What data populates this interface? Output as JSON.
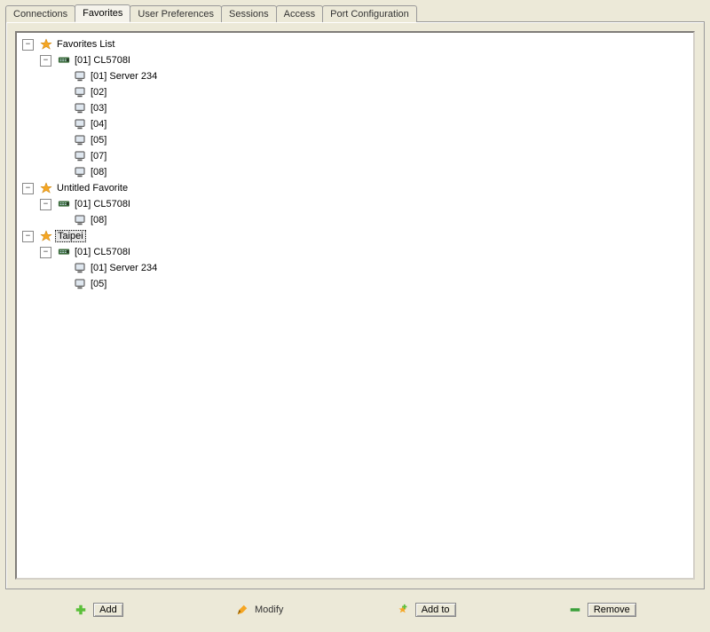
{
  "tabs": [
    {
      "label": "Connections",
      "active": false
    },
    {
      "label": "Favorites",
      "active": true
    },
    {
      "label": "User Preferences",
      "active": false
    },
    {
      "label": "Sessions",
      "active": false
    },
    {
      "label": "Access",
      "active": false
    },
    {
      "label": "Port Configuration",
      "active": false
    }
  ],
  "selected_label": "Taipei",
  "tree": [
    {
      "kind": "favorite",
      "label": "Favorites List",
      "expanded": true,
      "children": [
        {
          "kind": "switch",
          "label": "[01] CL5708I",
          "expanded": true,
          "children": [
            {
              "kind": "port",
              "label": "[01] Server 234"
            },
            {
              "kind": "port",
              "label": "[02]"
            },
            {
              "kind": "port",
              "label": "[03]"
            },
            {
              "kind": "port",
              "label": "[04]"
            },
            {
              "kind": "port",
              "label": "[05]"
            },
            {
              "kind": "port",
              "label": "[07]"
            },
            {
              "kind": "port",
              "label": "[08]"
            }
          ]
        }
      ]
    },
    {
      "kind": "favorite",
      "label": "Untitled Favorite",
      "expanded": true,
      "children": [
        {
          "kind": "switch",
          "label": "[01] CL5708I",
          "expanded": true,
          "children": [
            {
              "kind": "port",
              "label": "[08]"
            }
          ]
        }
      ]
    },
    {
      "kind": "favorite",
      "label": "Taipei",
      "expanded": true,
      "selected": true,
      "children": [
        {
          "kind": "switch",
          "label": "[01] CL5708I",
          "expanded": true,
          "children": [
            {
              "kind": "port",
              "label": "[01] Server 234"
            },
            {
              "kind": "port",
              "label": "[05]"
            }
          ]
        }
      ]
    }
  ],
  "toolbar": {
    "add": "Add",
    "modify": "Modify",
    "add_to": "Add to",
    "remove": "Remove"
  },
  "icons": {
    "expander_minus": "−",
    "expander_plus": "+"
  }
}
